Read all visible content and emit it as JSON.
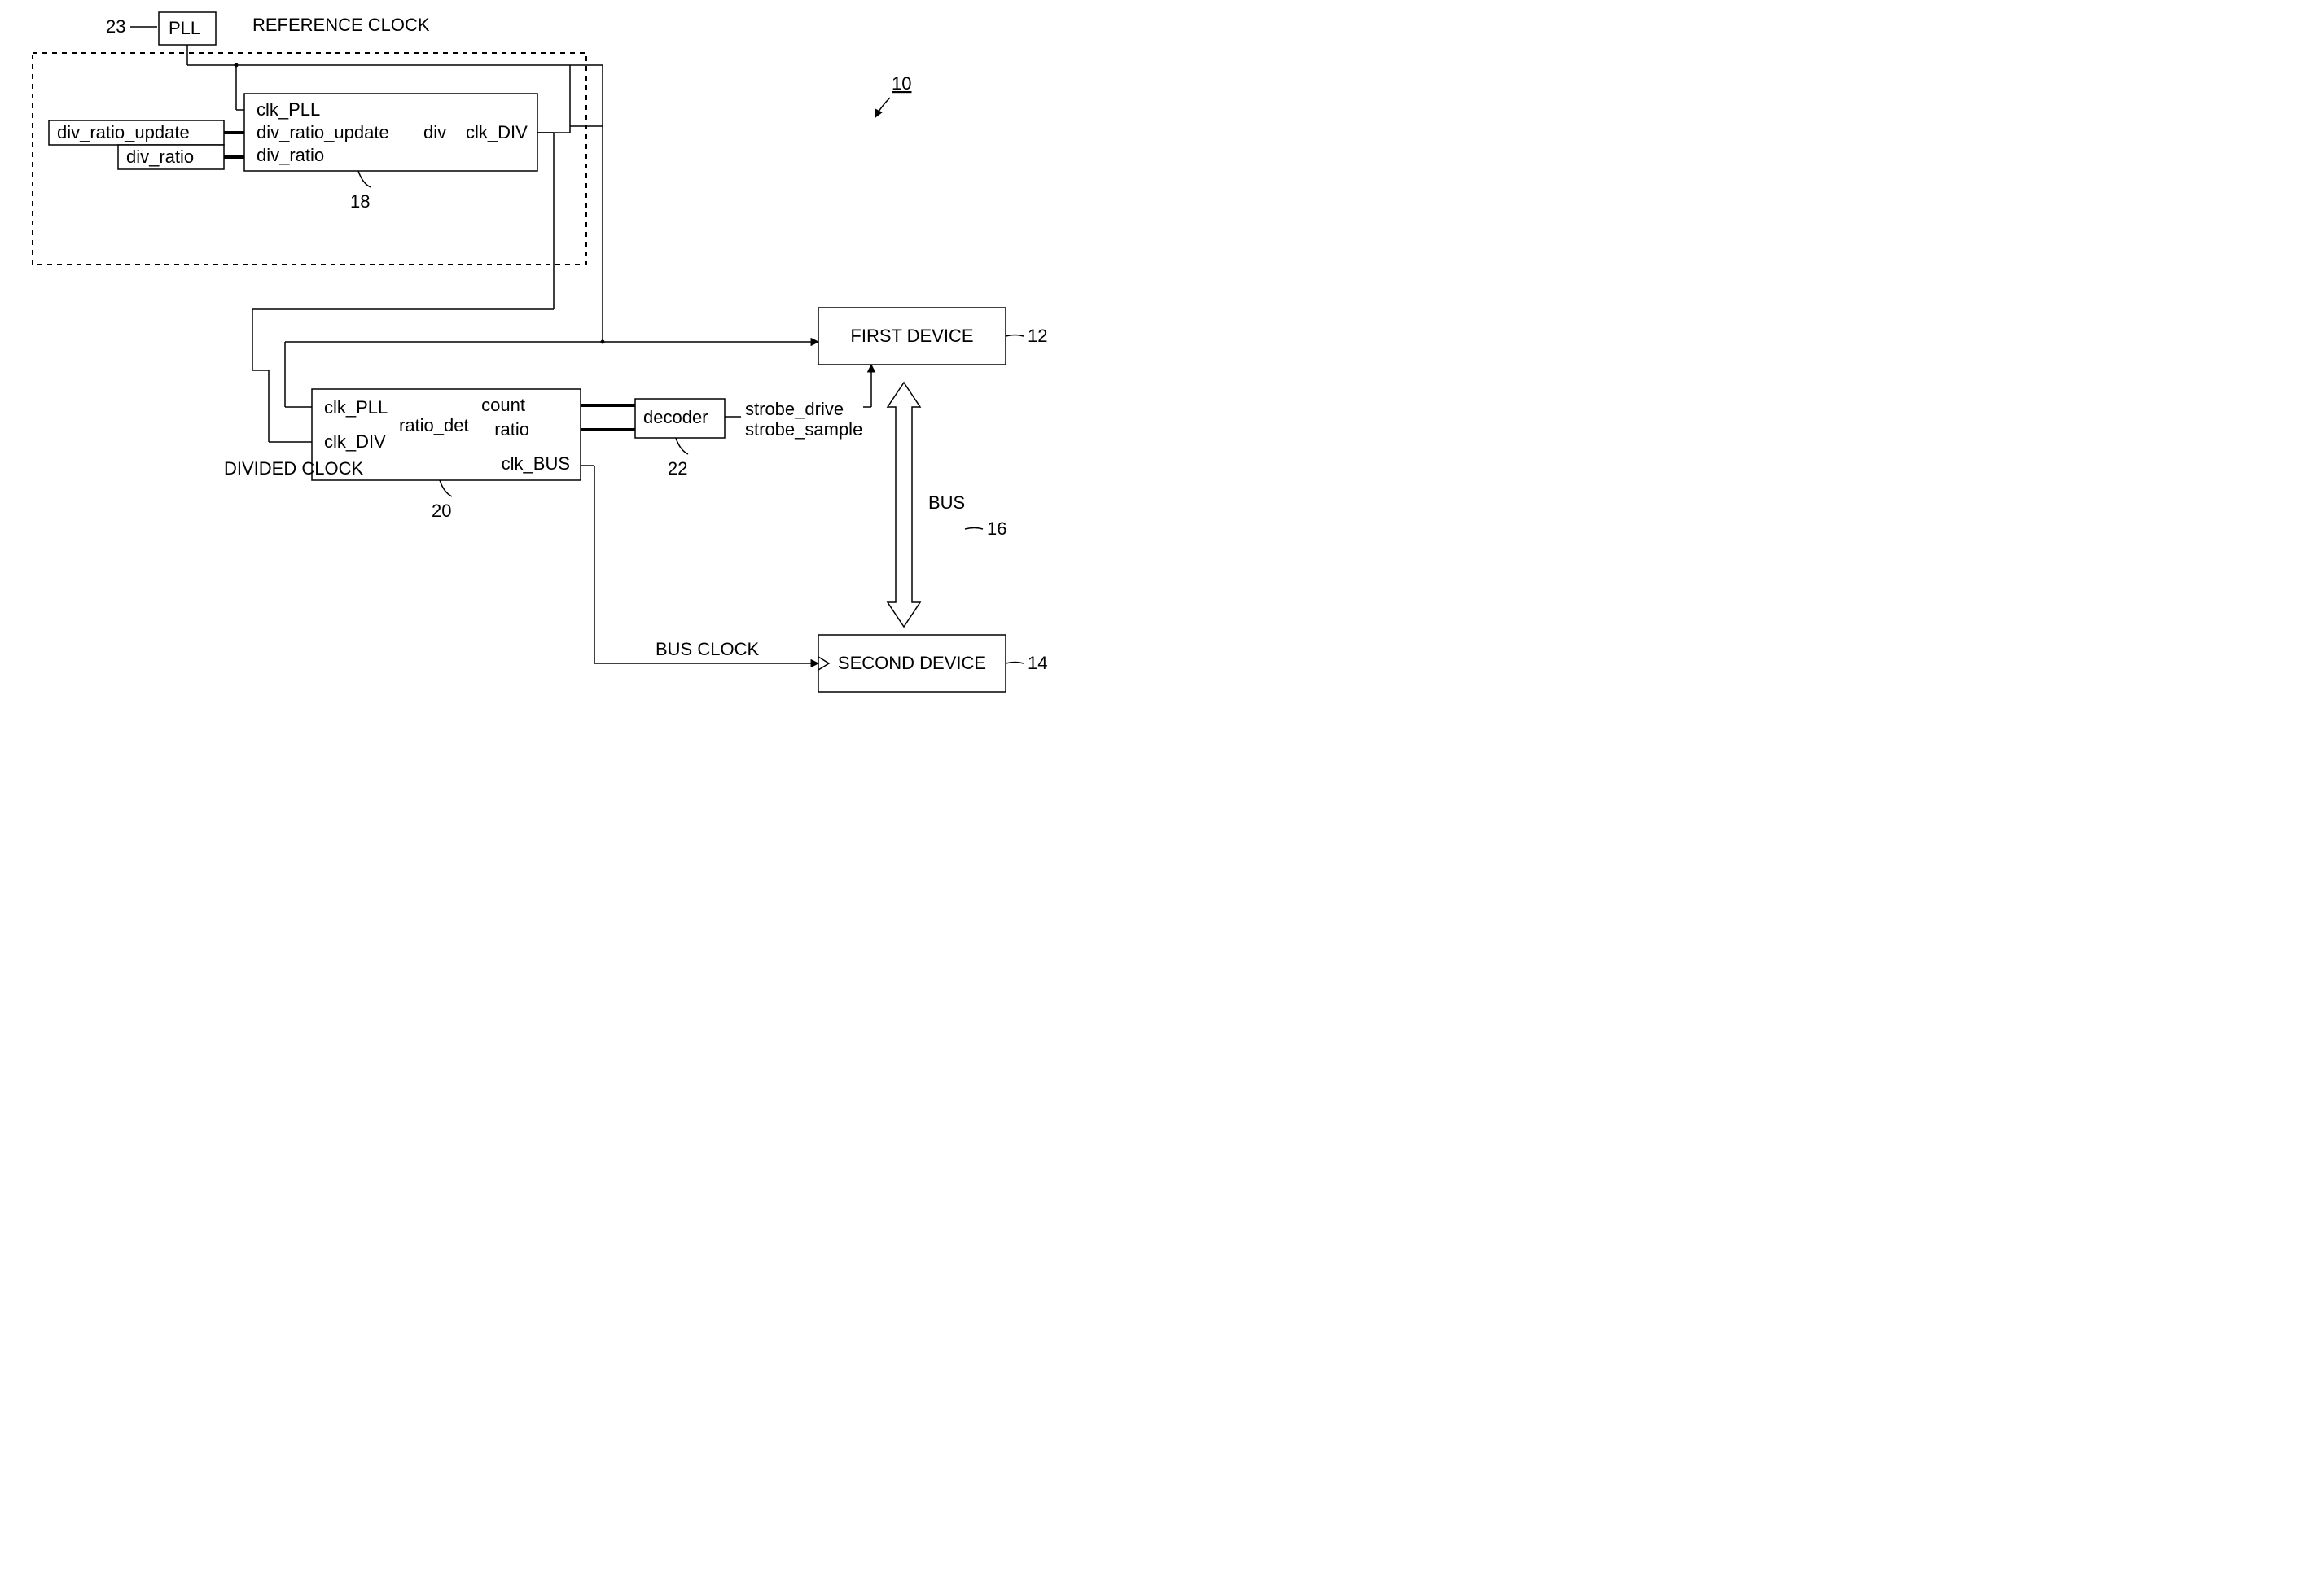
{
  "labels": {
    "ref_clock": "REFERENCE CLOCK",
    "divided_clock": "DIVIDED CLOCK",
    "bus_clock": "BUS CLOCK",
    "pll_box": "PLL",
    "div_ratio_update_box": "div_ratio_update",
    "div_ratio_box": "div_ratio",
    "block18_in_clk_pll": "clk_PLL",
    "block18_in_dru": "div_ratio_update",
    "block18_in_dr": "div_ratio",
    "block18_center": "div",
    "block18_out": "clk_DIV",
    "block20_in_clk_pll": "clk_PLL",
    "block20_in_clk_div": "clk_DIV",
    "block20_center": "ratio_det",
    "block20_out_count": "count",
    "block20_out_ratio": "ratio",
    "block20_out_clk_bus": "clk_BUS",
    "decoder_box": "decoder",
    "strobe_drive": "strobe_drive",
    "strobe_sample": "strobe_sample",
    "first_device": "FIRST DEVICE",
    "second_device": "SECOND DEVICE",
    "bus": "BUS",
    "ref_23": "23",
    "ref_18": "18",
    "ref_20": "20",
    "ref_22": "22",
    "ref_10": "10",
    "ref_12": "12",
    "ref_14": "14",
    "ref_16": "16"
  }
}
